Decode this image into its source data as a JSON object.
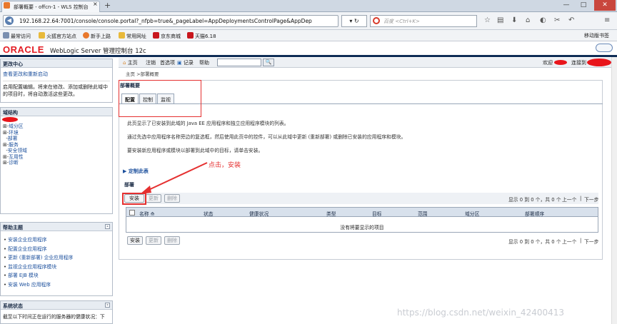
{
  "browser": {
    "tab_title": "部署概要 - offcn-1 - WLS 控制台",
    "new_tab": "+",
    "url": "192.168.22.64:7001/console/console.portal?_nfpb=true&_pageLabel=AppDeploymentsControlPage&AppDep",
    "search_placeholder": "百度 <Ctrl+K>"
  },
  "bookmarks": {
    "items": [
      "最常访问",
      "火狐官方站点",
      "新手上路",
      "常用网址",
      "京东商城",
      "天猫6.18"
    ],
    "mobile": "移动版书签"
  },
  "header": {
    "logo": "ORACLE",
    "title": "WebLogic Server 管理控制台 12c"
  },
  "change_center": {
    "title": "更改中心",
    "link": "查看更改和重新启动",
    "text_line1": "启用配置编辑。将来在修改、添加或删除此域中",
    "text_line2": "的项目时，将自动激活这些更改。"
  },
  "domain_structure": {
    "title": "域结构",
    "items": [
      "域分区",
      "环境",
      "部署",
      "服务",
      "安全领域",
      "互用性",
      "诊断"
    ]
  },
  "help": {
    "title": "帮助主题",
    "items": [
      "安装企业应用程序",
      "配置企业应用程序",
      "更新 (重新部署) 企业应用程序",
      "监视企业应用程序模块",
      "部署 EJB 模块",
      "安装 Web 应用程序"
    ]
  },
  "system_status": {
    "title": "系统状态",
    "text": "截至以下时间正在运行的服务器的健康状况：下"
  },
  "toolbar": {
    "home": "主页",
    "logout": "注销",
    "prefs": "首选项",
    "record": "记录",
    "help": "帮助",
    "welcome": "欢迎",
    "connected": "连接到"
  },
  "breadcrumb": "主页 >部署概要",
  "content": {
    "title": "部署概要",
    "tabs": [
      "配置",
      "控制",
      "监视"
    ],
    "para1": "此页显示了已安装到此域的 Java EE 应用程序和独立应用程序模块的列表。",
    "para2": "通过先选中应用程序名称旁边的复选框，然后使用此页中的控件，可以从此域中更新 (重新部署) 或删除已安装的应用程序和模块。",
    "para3": "要安装新应用程序或模块以部署到此域中的目标，请单击安装。",
    "customize": "定制此表",
    "section": "部署"
  },
  "buttons": {
    "install": "安装",
    "update": "更新",
    "delete": "删除"
  },
  "pager": {
    "range": "显示 0 到 0 个，共 0 个",
    "prev": "上一个",
    "next": "下一步"
  },
  "table": {
    "headers": [
      "名称 ⟰",
      "状态",
      "健康状况",
      "类型",
      "目标",
      "范围",
      "域分区",
      "部署顺序"
    ],
    "empty": "没有将要显示的项目"
  },
  "annotation": "点击，安装",
  "watermark": "https://blog.csdn.net/weixin_42400413",
  "colors": {
    "oracle_red": "#e31b23",
    "nav_dark": "#0f2d56",
    "annotation": "#e53030"
  }
}
